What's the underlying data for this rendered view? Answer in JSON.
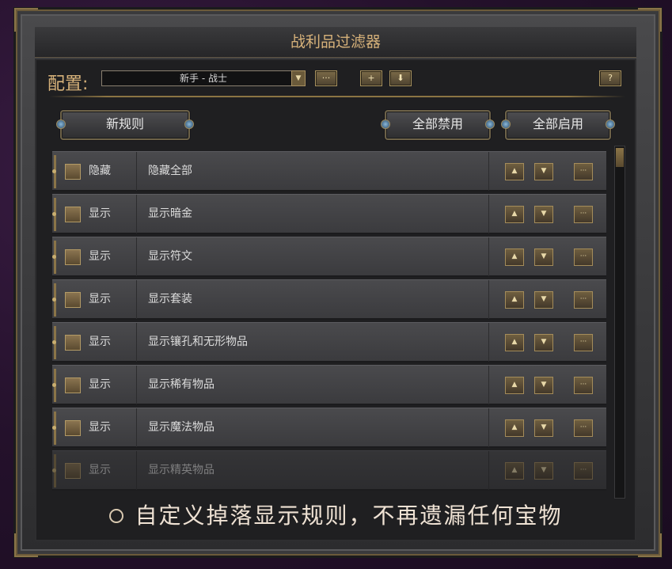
{
  "window": {
    "title": "战利品过滤器"
  },
  "config": {
    "label": "配置:",
    "selected": "新手 - 战士",
    "more_label": "···",
    "add_label": "+",
    "import_label": "⬇",
    "help_label": "?"
  },
  "toolbar": {
    "new_rule": "新规则",
    "disable_all": "全部禁用",
    "enable_all": "全部启用"
  },
  "rules": [
    {
      "action": "隐藏",
      "name": "隐藏全部"
    },
    {
      "action": "显示",
      "name": "显示暗金"
    },
    {
      "action": "显示",
      "name": "显示符文"
    },
    {
      "action": "显示",
      "name": "显示套装"
    },
    {
      "action": "显示",
      "name": "显示镶孔和无形物品"
    },
    {
      "action": "显示",
      "name": "显示稀有物品"
    },
    {
      "action": "显示",
      "name": "显示魔法物品"
    },
    {
      "action": "显示",
      "name": "显示精英物品"
    }
  ],
  "row_buttons": {
    "up": "▲",
    "down": "▼",
    "more": "···"
  },
  "caption": "自定义掉落显示规则，不再遗漏任何宝物",
  "colors": {
    "accent": "#d7b27a",
    "frame": "#8a7448",
    "background": "#2a1430"
  }
}
